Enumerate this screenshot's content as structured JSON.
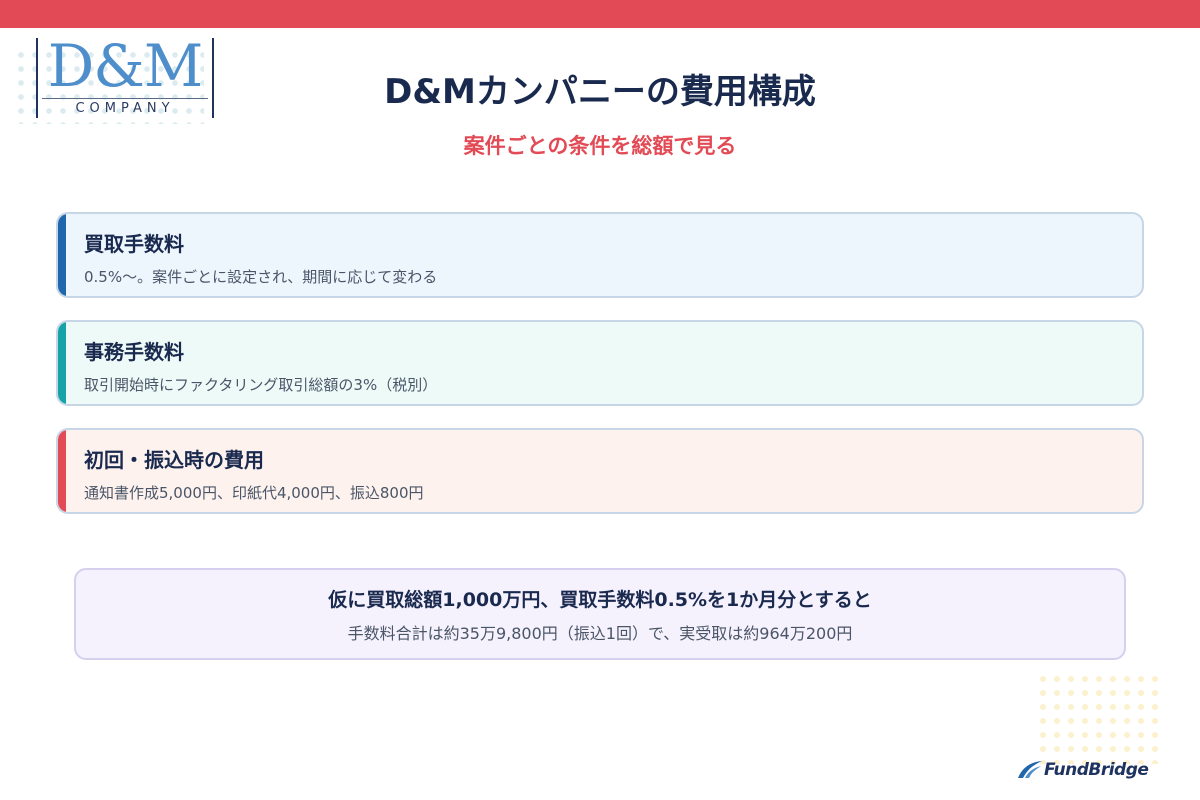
{
  "colors": {
    "brand_red": "#e24b55",
    "navy": "#1a2a4f",
    "blue": "#2066ad",
    "teal": "#16a3a7",
    "logo_blue": "#4d8ecb"
  },
  "logo": {
    "main": "D&M",
    "sub": "COMPANY"
  },
  "header": {
    "title": "D&Mカンパニーの費用構成",
    "subtitle": "案件ごとの条件を総額で見る"
  },
  "fees": [
    {
      "title": "買取手数料",
      "description": "0.5%〜。案件ごとに設定され、期間に応じて変わる"
    },
    {
      "title": "事務手数料",
      "description": "取引開始時にファクタリング取引総額の3%（税別）"
    },
    {
      "title": "初回・振込時の費用",
      "description": "通知書作成5,000円、印紙代4,000円、振込800円"
    }
  ],
  "summary": {
    "headline": "仮に買取総額1,000万円、買取手数料0.5%を1か月分とすると",
    "detail": "手数料合計は約35万9,800円（振込1回）で、実受取は約964万200円"
  },
  "footer": {
    "brand_icon": "fundbridge-wing-icon",
    "brand_name": "FundBridge"
  }
}
